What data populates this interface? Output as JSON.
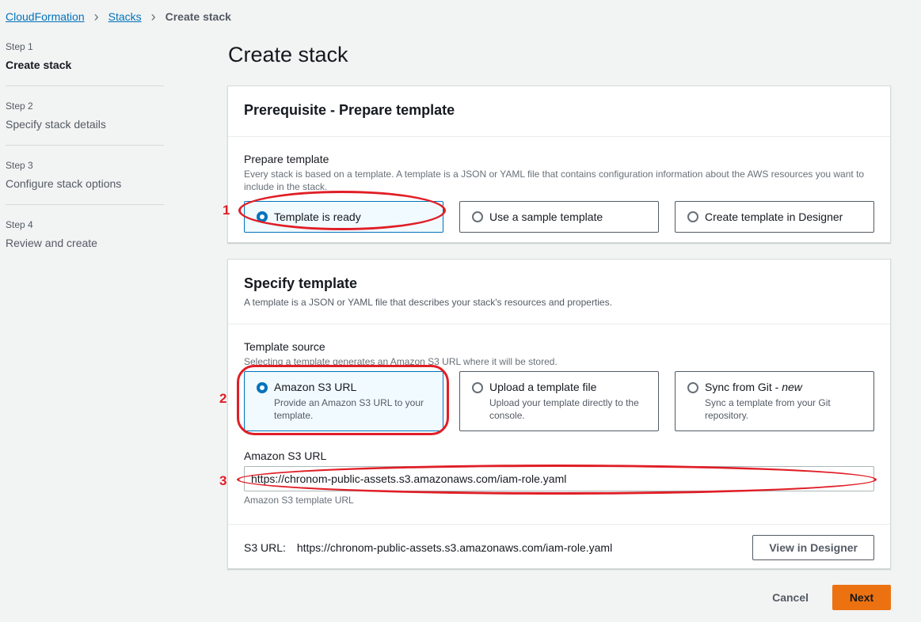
{
  "breadcrumb": {
    "items": [
      {
        "label": "CloudFormation"
      },
      {
        "label": "Stacks"
      }
    ],
    "current": "Create stack"
  },
  "steps": [
    {
      "num": "Step 1",
      "label": "Create stack"
    },
    {
      "num": "Step 2",
      "label": "Specify stack details"
    },
    {
      "num": "Step 3",
      "label": "Configure stack options"
    },
    {
      "num": "Step 4",
      "label": "Review and create"
    }
  ],
  "page_title": "Create stack",
  "prerequisite": {
    "title": "Prerequisite - Prepare template",
    "field_label": "Prepare template",
    "field_desc": "Every stack is based on a template. A template is a JSON or YAML file that contains configuration information about the AWS resources you want to include in the stack.",
    "options": [
      {
        "label": "Template is ready",
        "selected": true
      },
      {
        "label": "Use a sample template",
        "selected": false
      },
      {
        "label": "Create template in Designer",
        "selected": false
      }
    ]
  },
  "specify": {
    "title": "Specify template",
    "desc": "A template is a JSON or YAML file that describes your stack's resources and properties.",
    "source_label": "Template source",
    "source_desc": "Selecting a template generates an Amazon S3 URL where it will be stored.",
    "options": [
      {
        "label": "Amazon S3 URL",
        "desc": "Provide an Amazon S3 URL to your template.",
        "selected": true
      },
      {
        "label": "Upload a template file",
        "desc": "Upload your template directly to the console.",
        "selected": false
      },
      {
        "label": "Sync from Git - ",
        "label_em": "new",
        "desc": "Sync a template from your Git repository.",
        "selected": false
      }
    ],
    "url_label": "Amazon S3 URL",
    "url_value": "https://chronom-public-assets.s3.amazonaws.com/iam-role.yaml",
    "url_constraint": "Amazon S3 template URL",
    "s3_label": "S3 URL:",
    "s3_value": "https://chronom-public-assets.s3.amazonaws.com/iam-role.yaml",
    "designer_button": "View in Designer"
  },
  "actions": {
    "cancel": "Cancel",
    "next": "Next"
  },
  "annotations": [
    "1",
    "2",
    "3"
  ],
  "colors": {
    "accent": "#0073bb",
    "primary_button": "#ec7211",
    "annotation": "#e01e26"
  }
}
